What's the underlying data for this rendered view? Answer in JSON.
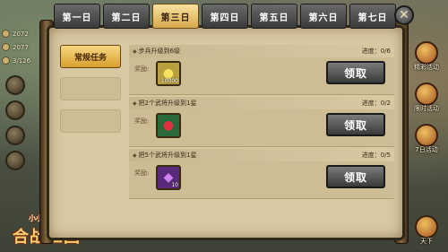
{
  "hud": {
    "resources": [
      "2072",
      "2077",
      "3/126"
    ],
    "logo_small": "小小军团",
    "logo_big": "合战三国",
    "side_events": [
      "精彩活动",
      "限时活动",
      "7日活动",
      "天下"
    ]
  },
  "tabs": [
    {
      "label": "第一日",
      "active": false
    },
    {
      "label": "第二日",
      "active": false
    },
    {
      "label": "第三日",
      "active": true
    },
    {
      "label": "第四日",
      "active": false
    },
    {
      "label": "第五日",
      "active": false
    },
    {
      "label": "第六日",
      "active": false
    },
    {
      "label": "第七日",
      "active": false
    }
  ],
  "close_label": "✕",
  "categories": [
    {
      "label": "常规任务",
      "active": true
    },
    {
      "label": "",
      "active": false
    },
    {
      "label": "",
      "active": false
    }
  ],
  "reward_label": "奖励:",
  "tasks": [
    {
      "title": "步兵升级到6级",
      "progress": "进度：0/6",
      "item_icon": "gold-coin-icon",
      "item_color": "#b8a040",
      "item_count": "10000",
      "claim_label": "领取"
    },
    {
      "title": "把2个武将升级到1星",
      "progress": "进度：0/2",
      "item_icon": "red-fruit-icon",
      "item_color": "#2a6a3a",
      "item_count": "",
      "claim_label": "领取"
    },
    {
      "title": "把5个武将升级到1星",
      "progress": "进度：0/5",
      "item_icon": "purple-gem-icon",
      "item_color": "#5a2a7a",
      "item_count": "10",
      "claim_label": "领取"
    }
  ]
}
